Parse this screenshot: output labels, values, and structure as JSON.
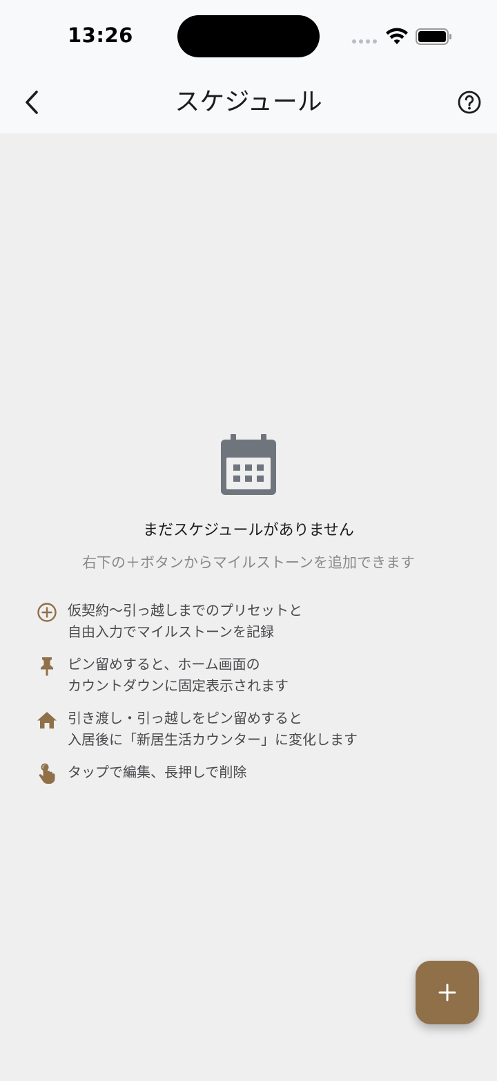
{
  "status_bar": {
    "time": "13:26"
  },
  "header": {
    "title": "スケジュール",
    "back_icon": "chevron-left-icon",
    "help_icon": "question-circle-icon"
  },
  "empty_state": {
    "icon": "calendar-icon",
    "title": "まだスケジュールがありません",
    "subtitle": "右下の＋ボタンからマイルストーンを追加できます"
  },
  "tips": [
    {
      "icon": "add-circle-icon",
      "line1": "仮契約〜引っ越しまでのプリセットと",
      "line2": "自由入力でマイルストーンを記録"
    },
    {
      "icon": "pin-icon",
      "line1": "ピン留めすると、ホーム画面の",
      "line2": "カウントダウンに固定表示されます"
    },
    {
      "icon": "home-icon",
      "line1": "引き渡し・引っ越しをピン留めすると",
      "line2": "入居後に「新居生活カウンター」に変化します"
    },
    {
      "icon": "touch-icon",
      "line1": "タップで編集、長押しで削除",
      "line2": ""
    }
  ],
  "fab": {
    "icon": "plus-icon"
  },
  "colors": {
    "accent": "#8f7049",
    "background": "#efefef",
    "header_bg": "#f8f9fb",
    "empty_icon": "#6f757d"
  }
}
